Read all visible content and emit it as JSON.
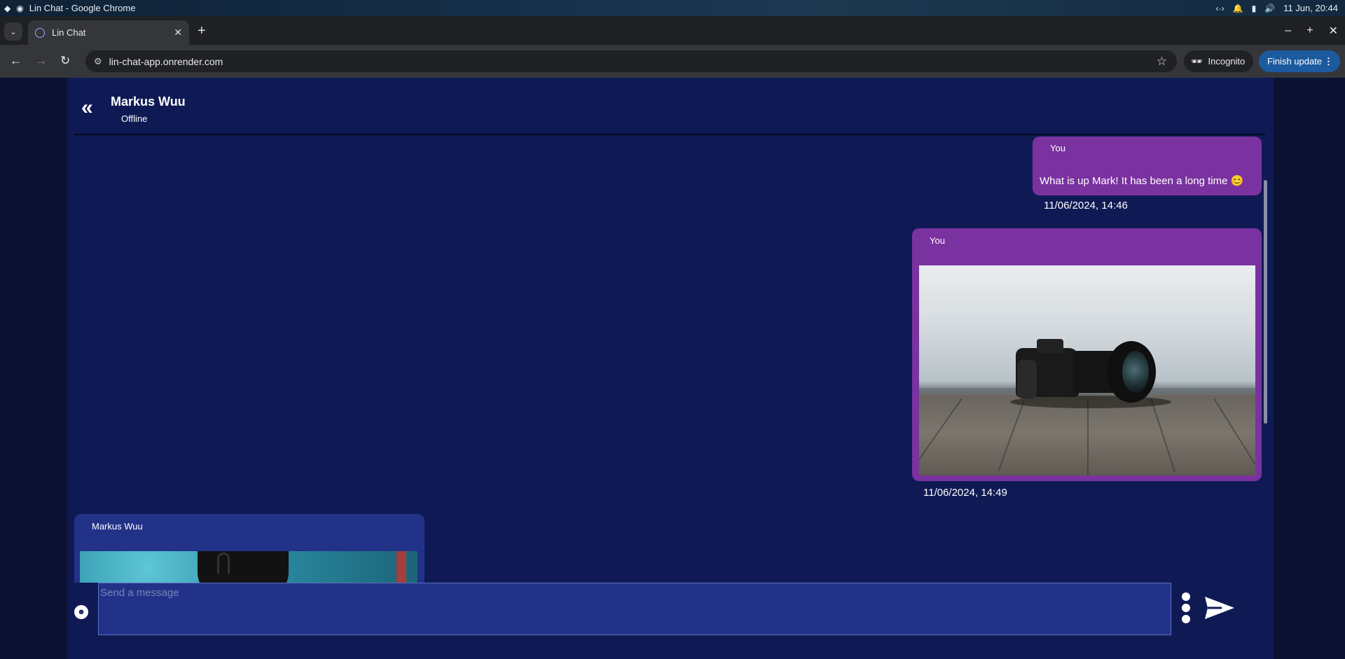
{
  "os": {
    "window_title": "Lin Chat - Google Chrome",
    "clock": "11 Jun, 20:44"
  },
  "browser": {
    "tab_title": "Lin Chat",
    "url": "lin-chat-app.onrender.com",
    "incognito_label": "Incognito",
    "finish_update_label": "Finish update"
  },
  "chat": {
    "contact_name": "Markus Wuu",
    "contact_status": "Offline",
    "messages": [
      {
        "sender": "You",
        "text": "What is up Mark! It has been a long time 😊",
        "timestamp": "11/06/2024, 14:46"
      },
      {
        "sender": "You",
        "image": "camera on wooden pier",
        "timestamp": "11/06/2024, 14:49"
      },
      {
        "sender": "Markus Wuu",
        "image": "dark horned helmet on teal background"
      }
    ]
  },
  "composer": {
    "placeholder": "Send a message"
  },
  "colors": {
    "panel_bg": "#0f1a55",
    "outgoing_bubble": "#7a32a0",
    "incoming_bubble": "#223288",
    "finish_update_btn": "#1c5aa0"
  }
}
